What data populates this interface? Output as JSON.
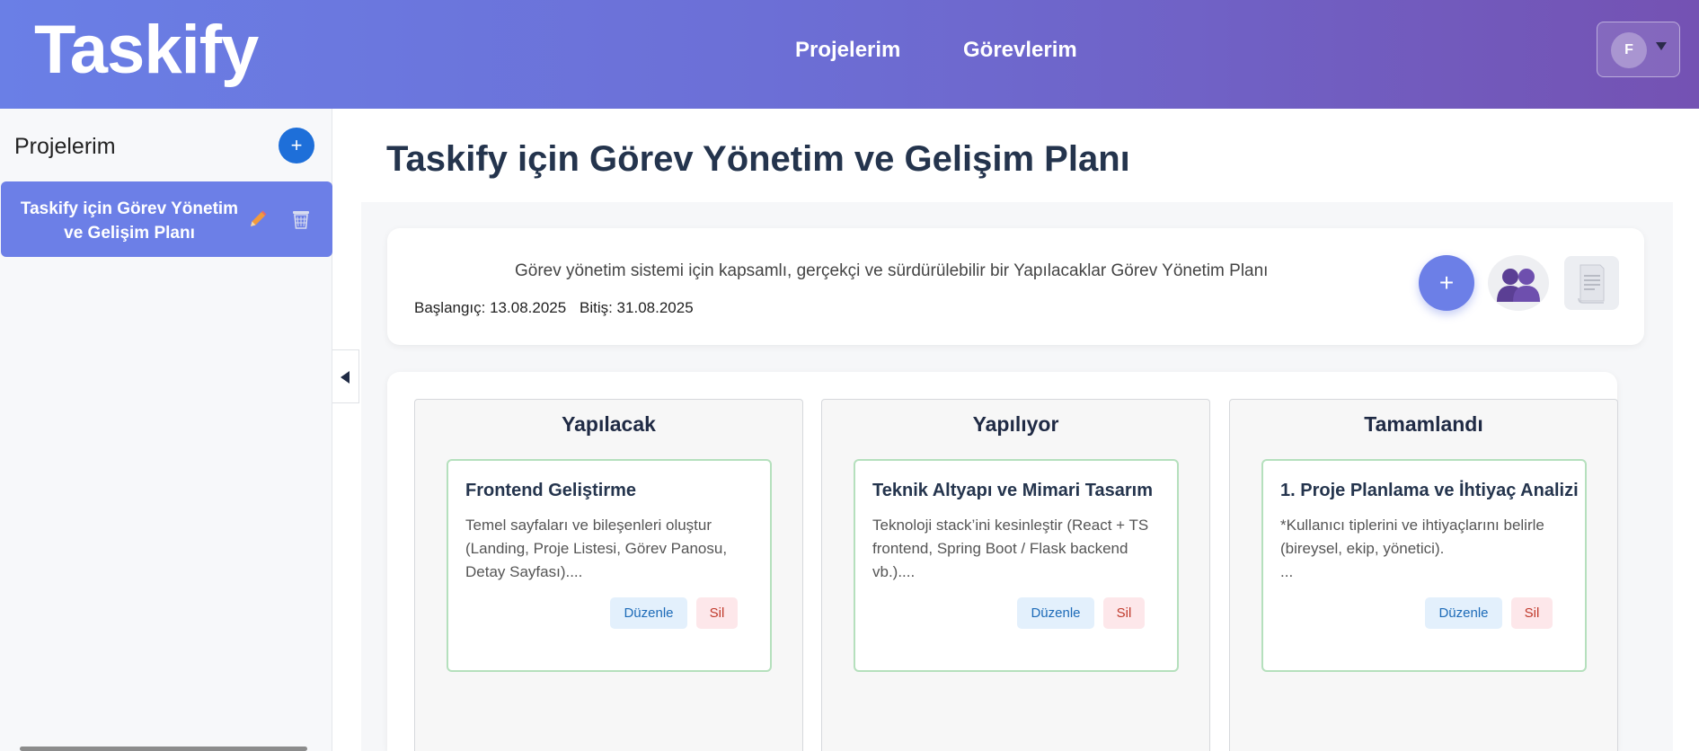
{
  "header": {
    "logo": "Taskify",
    "nav": [
      "Projelerim",
      "Görevlerim"
    ],
    "user_initial": "F"
  },
  "sidebar": {
    "title": "Projelerim",
    "add_label": "+",
    "projects": [
      {
        "name": "Taskify için Görev Yönetim ve Gelişim Planı"
      }
    ]
  },
  "main": {
    "title": "Taskify için Görev Yönetim ve Gelişim Planı",
    "description": "Görev yönetim sistemi için kapsamlı, gerçekçi ve sürdürülebilir bir Yapılacaklar Görev Yönetim Planı",
    "start": "Başlangıç: 13.08.2025",
    "end": "Bitiş: 31.08.2025",
    "add_label": "+",
    "edit_label": "Düzenle",
    "delete_label": "Sil",
    "columns": [
      {
        "title": "Yapılacak",
        "tasks": [
          {
            "title": "Frontend Geliştirme",
            "desc": "Temel sayfaları ve bileşenleri oluştur (Landing, Proje Listesi, Görev Panosu, Detay Sayfası)...."
          }
        ]
      },
      {
        "title": "Yapılıyor",
        "tasks": [
          {
            "title": "Teknik Altyapı ve Mimari Tasarım",
            "desc": "Teknoloji stack’ini kesinleştir (React + TS frontend, Spring Boot / Flask backend vb.)...."
          }
        ]
      },
      {
        "title": "Tamamlandı",
        "tasks": [
          {
            "title": "1. Proje Planlama ve İhtiyaç Analizi",
            "desc": "*Kullanıcı tiplerini ve ihtiyaçlarını belirle (bireysel, ekip, yönetici).\n..."
          }
        ]
      }
    ]
  },
  "icons": [
    "user-avatar",
    "chevron-down-icon",
    "plus-icon",
    "pencil-icon",
    "trash-icon",
    "chevron-left-icon",
    "team-icon",
    "document-icon"
  ],
  "colors": {
    "primary": "#6c7fe7",
    "header_end": "#7452b3",
    "sidebar_add": "#1e6fd9",
    "card_border": "#b5e0bd"
  }
}
